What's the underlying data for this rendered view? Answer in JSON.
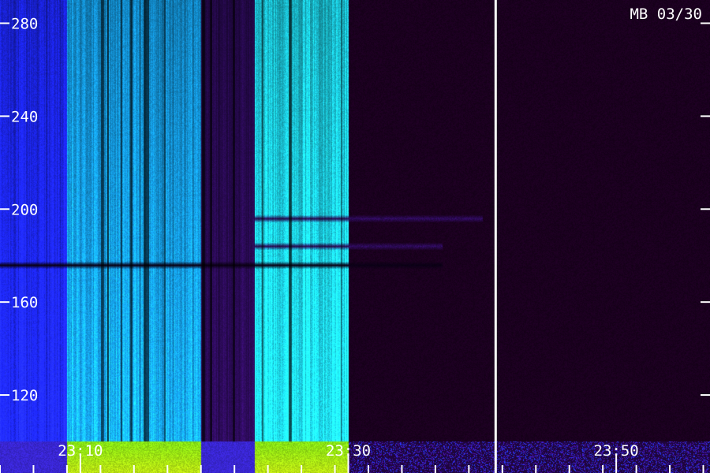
{
  "station_label": "MB 03/30",
  "chart_data": {
    "type": "heatmap",
    "title": "",
    "xlabel": "",
    "ylabel": "",
    "station": "MB",
    "date": "03/30",
    "x_range": [
      "23:04",
      "23:57"
    ],
    "y_range": [
      100,
      290
    ],
    "x_ticks": [
      "23:10",
      "23:30",
      "23:50"
    ],
    "y_ticks": [
      120,
      160,
      200,
      240,
      280
    ],
    "grid": false,
    "legend": "none",
    "colors": {
      "background": "#18001c",
      "weak_signal": "#2a0a55",
      "medium_signal": "#1e28ff",
      "strong_signal": "#16a6f2",
      "intense_signal": "#20e8ff",
      "ground_band_hot": "#c8f000",
      "tick_color": "#ffffff",
      "time_marker": "#ffffff"
    },
    "time_marker": "23:41",
    "bands": [
      {
        "start": "23:04",
        "end": "23:09",
        "level": "medium"
      },
      {
        "start": "23:09",
        "end": "23:19",
        "level": "strong"
      },
      {
        "start": "23:19",
        "end": "23:23",
        "level": "weak"
      },
      {
        "start": "23:23",
        "end": "23:30",
        "level": "intense"
      },
      {
        "start": "23:30",
        "end": "23:57",
        "level": "background"
      }
    ],
    "horizontal_features": [
      {
        "y": 176,
        "start": "23:04",
        "end": "23:37",
        "level": "dark"
      },
      {
        "y": 184,
        "start": "23:23",
        "end": "23:37",
        "level": "weak"
      },
      {
        "y": 196,
        "start": "23:23",
        "end": "23:40",
        "level": "weak"
      }
    ]
  }
}
